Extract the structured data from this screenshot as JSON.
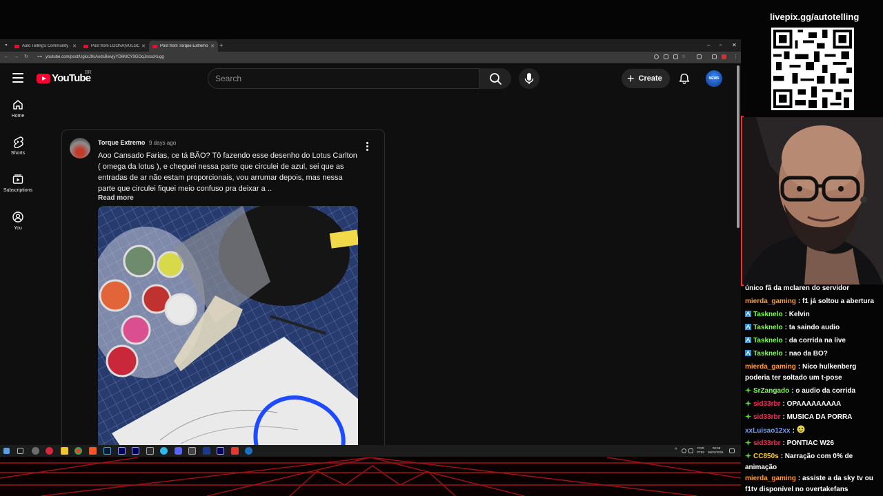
{
  "browser": {
    "tabs": [
      {
        "label": "Auto Telling's Community - Yo"
      },
      {
        "label": "Post from LOONA|VULGO GHO"
      },
      {
        "label": "Post from Torque Extremo - Yo"
      }
    ],
    "url": "youtube.com/post/UgkxJ9sAodsBwvjyYD6MCY9GOqJnsscKugg"
  },
  "youtube": {
    "logo_text": "YouTube",
    "region": "BR",
    "search_placeholder": "Search",
    "create_label": "Create",
    "avatar_text": "NEWS",
    "sidebar": [
      {
        "label": "Home",
        "icon": "home-icon"
      },
      {
        "label": "Shorts",
        "icon": "shorts-icon"
      },
      {
        "label": "Subscriptions",
        "icon": "subscriptions-icon"
      },
      {
        "label": "You",
        "icon": "you-icon"
      }
    ],
    "post": {
      "channel": "Torque Extremo",
      "date": "9 days ago",
      "text": "Aoo Cansado Farias, ce tá BÃO? Tô fazendo esse desenho do Lotus Carlton ( omega da lotus ), e cheguei nessa parte que circulei de azul, sei que as entradas de ar não estam proporcionais, vou arrumar depois, mas nessa parte que circulei fiquei meio confuso pra deixar a ..",
      "read_more": "Read more"
    }
  },
  "taskbar": {
    "lang_top": "POR",
    "lang_bottom": "PTB2",
    "time": "00:59",
    "date": "06/03/2026"
  },
  "overlay": {
    "livepix": "livepix.gg/autotelling"
  },
  "chat": [
    {
      "user": "",
      "text": "único fã da mclaren do servidor",
      "color": "#ffffff",
      "badge": ""
    },
    {
      "user": "mierda_gaming",
      "text": ": f1 já soltou a abertura",
      "color": "#ff9933",
      "badge": ""
    },
    {
      "user": "Tasknelo",
      "text": ": Kelvin",
      "color": "#7cff4a",
      "badge": "prime"
    },
    {
      "user": "Tasknelo",
      "text": ": ta saindo audio",
      "color": "#7cff4a",
      "badge": "prime"
    },
    {
      "user": "Tasknelo",
      "text": ": da corrida na live",
      "color": "#7cff4a",
      "badge": "prime"
    },
    {
      "user": "Tasknelo",
      "text": ": nao da BO?",
      "color": "#7cff4a",
      "badge": "prime"
    },
    {
      "user": "mierda_gaming",
      "text": ": Nico hulkenberg poderia ter soltado um t-pose",
      "color": "#ff9933",
      "badge": ""
    },
    {
      "user": "SrZangado",
      "text": ": o audio da corrida",
      "color": "#7cff4a",
      "badge": "sub"
    },
    {
      "user": "sid33rbr",
      "text": ": OPAAAAAAAAA",
      "color": "#ff2a55",
      "badge": "sub"
    },
    {
      "user": "sid33rbr",
      "text": ": MUSICA DA PORRA",
      "color": "#ff2a55",
      "badge": "sub"
    },
    {
      "user": "xxLuisao12xx",
      "text": ":",
      "color": "#6f9dff",
      "badge": ""
    },
    {
      "user": "sid33rbr",
      "text": ": PONTIAC W26",
      "color": "#ff2a55",
      "badge": "sub"
    },
    {
      "user": "CC850s",
      "text": ": Narração com 0% de animação",
      "color": "#ffcc33",
      "badge": "sub"
    },
    {
      "user": "mierda_gaming",
      "text": ": assiste a da sky tv ou f1tv disponível no overtakefans",
      "color": "#ff9933",
      "badge": ""
    }
  ]
}
